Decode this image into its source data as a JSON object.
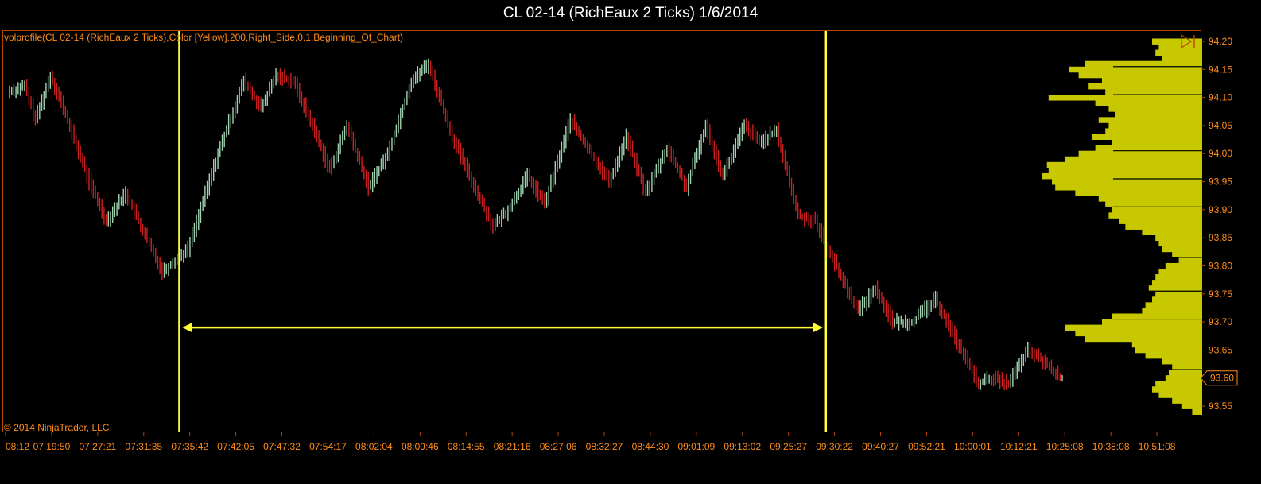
{
  "window": {
    "title": "CL 02-14 (RichEaux 2 Ticks)  1/6/2014"
  },
  "indicator_label": "volprofile(CL 02-14 (RichEaux 2 Ticks),Color [Yellow],200,Right_Side,0.1,Beginning_Of_Chart)",
  "copyright": "© 2014 NinjaTrader, LLC",
  "colors": {
    "background": "#000000",
    "up_bar": "#9fd3b0",
    "down_bar": "#cc2020",
    "volume_profile": "#c8c800",
    "annotation": "#ffff33",
    "axis_text": "#ff8c1a",
    "frame": "#b34700"
  },
  "chart_data": {
    "type": "line",
    "instrument": "CL 02-14",
    "bar_type": "RichEaux 2 Ticks",
    "date": "1/6/2014",
    "ylim": [
      93.52,
      94.21
    ],
    "y_ticks": [
      94.2,
      94.15,
      94.1,
      94.05,
      94.0,
      93.95,
      93.9,
      93.85,
      93.8,
      93.75,
      93.7,
      93.65,
      93.6,
      93.55
    ],
    "y_tick_labels": [
      "94.20",
      "94.15",
      "94.10",
      "94.05",
      "94.00",
      "93.95",
      "93.90",
      "93.85",
      "93.80",
      "93.75",
      "93.70",
      "93.65",
      "93.60",
      "93.55"
    ],
    "x_tick_labels": [
      "08:12",
      "07:19:50",
      "07:27:21",
      "07:31:35",
      "07:35:42",
      "07:42:05",
      "07:47:32",
      "07:54:17",
      "08:02:04",
      "08:09:46",
      "08:14:55",
      "08:21:16",
      "08:27:06",
      "08:32:27",
      "08:44:30",
      "09:01:09",
      "09:13:02",
      "09:25:27",
      "09:30:22",
      "09:40:27",
      "09:52:21",
      "10:00:01",
      "10:12:21",
      "10:25:08",
      "10:38:08",
      "10:51:08"
    ],
    "x_tick_count_span": 27,
    "bar_count": 220,
    "price_path": [
      {
        "bar": 0,
        "price": 94.11
      },
      {
        "bar": 8,
        "price": 94.12
      },
      {
        "bar": 13,
        "price": 94.06
      },
      {
        "bar": 20,
        "price": 94.14
      },
      {
        "bar": 26,
        "price": 94.08
      },
      {
        "bar": 38,
        "price": 93.95
      },
      {
        "bar": 46,
        "price": 93.88
      },
      {
        "bar": 55,
        "price": 93.93
      },
      {
        "bar": 62,
        "price": 93.87
      },
      {
        "bar": 72,
        "price": 93.79
      },
      {
        "bar": 84,
        "price": 93.83
      },
      {
        "bar": 98,
        "price": 94.0
      },
      {
        "bar": 110,
        "price": 94.13
      },
      {
        "bar": 118,
        "price": 94.08
      },
      {
        "bar": 125,
        "price": 94.14
      },
      {
        "bar": 133,
        "price": 94.13
      },
      {
        "bar": 143,
        "price": 94.04
      },
      {
        "bar": 150,
        "price": 93.97
      },
      {
        "bar": 158,
        "price": 94.05
      },
      {
        "bar": 168,
        "price": 93.94
      },
      {
        "bar": 177,
        "price": 94.0
      },
      {
        "bar": 188,
        "price": 94.13
      },
      {
        "bar": 196,
        "price": 94.16
      },
      {
        "bar": 207,
        "price": 94.03
      },
      {
        "bar": 215,
        "price": 93.96
      },
      {
        "bar": 226,
        "price": 93.87
      },
      {
        "bar": 233,
        "price": 93.9
      },
      {
        "bar": 242,
        "price": 93.96
      },
      {
        "bar": 250,
        "price": 93.91
      },
      {
        "bar": 262,
        "price": 94.06
      },
      {
        "bar": 270,
        "price": 94.01
      },
      {
        "bar": 280,
        "price": 93.95
      },
      {
        "bar": 288,
        "price": 94.03
      },
      {
        "bar": 297,
        "price": 93.93
      },
      {
        "bar": 307,
        "price": 94.01
      },
      {
        "bar": 316,
        "price": 93.94
      },
      {
        "bar": 325,
        "price": 94.05
      },
      {
        "bar": 333,
        "price": 93.96
      },
      {
        "bar": 343,
        "price": 94.05
      },
      {
        "bar": 350,
        "price": 94.02
      },
      {
        "bar": 358,
        "price": 94.04
      },
      {
        "bar": 368,
        "price": 93.89
      },
      {
        "bar": 376,
        "price": 93.88
      },
      {
        "bar": 388,
        "price": 93.78
      },
      {
        "bar": 396,
        "price": 93.72
      },
      {
        "bar": 404,
        "price": 93.76
      },
      {
        "bar": 412,
        "price": 93.7
      },
      {
        "bar": 421,
        "price": 93.7
      },
      {
        "bar": 432,
        "price": 93.74
      },
      {
        "bar": 440,
        "price": 93.68
      },
      {
        "bar": 452,
        "price": 93.59
      },
      {
        "bar": 458,
        "price": 93.6
      },
      {
        "bar": 466,
        "price": 93.59
      },
      {
        "bar": 475,
        "price": 93.65
      },
      {
        "bar": 482,
        "price": 93.63
      },
      {
        "bar": 490,
        "price": 93.6
      }
    ],
    "volume_profile": [
      {
        "price": 94.2,
        "volume": 0.3
      },
      {
        "price": 94.19,
        "volume": 0.26
      },
      {
        "price": 94.18,
        "volume": 0.28
      },
      {
        "price": 94.17,
        "volume": 0.24
      },
      {
        "price": 94.16,
        "volume": 0.7
      },
      {
        "price": 94.15,
        "volume": 0.8
      },
      {
        "price": 94.14,
        "volume": 0.74
      },
      {
        "price": 94.13,
        "volume": 0.6
      },
      {
        "price": 94.12,
        "volume": 0.68
      },
      {
        "price": 94.11,
        "volume": 0.58
      },
      {
        "price": 94.1,
        "volume": 0.92
      },
      {
        "price": 94.09,
        "volume": 0.64
      },
      {
        "price": 94.08,
        "volume": 0.56
      },
      {
        "price": 94.07,
        "volume": 0.52
      },
      {
        "price": 94.06,
        "volume": 0.62
      },
      {
        "price": 94.05,
        "volume": 0.56
      },
      {
        "price": 94.04,
        "volume": 0.58
      },
      {
        "price": 94.03,
        "volume": 0.66
      },
      {
        "price": 94.02,
        "volume": 0.54
      },
      {
        "price": 94.01,
        "volume": 0.64
      },
      {
        "price": 94.0,
        "volume": 0.74
      },
      {
        "price": 93.99,
        "volume": 0.82
      },
      {
        "price": 93.98,
        "volume": 0.93
      },
      {
        "price": 93.97,
        "volume": 0.92
      },
      {
        "price": 93.96,
        "volume": 0.96
      },
      {
        "price": 93.95,
        "volume": 0.9
      },
      {
        "price": 93.94,
        "volume": 0.88
      },
      {
        "price": 93.93,
        "volume": 0.76
      },
      {
        "price": 93.92,
        "volume": 0.62
      },
      {
        "price": 93.91,
        "volume": 0.58
      },
      {
        "price": 93.9,
        "volume": 0.54
      },
      {
        "price": 93.89,
        "volume": 0.56
      },
      {
        "price": 93.88,
        "volume": 0.5
      },
      {
        "price": 93.87,
        "volume": 0.46
      },
      {
        "price": 93.86,
        "volume": 0.36
      },
      {
        "price": 93.85,
        "volume": 0.28
      },
      {
        "price": 93.84,
        "volume": 0.26
      },
      {
        "price": 93.83,
        "volume": 0.24
      },
      {
        "price": 93.82,
        "volume": 0.18
      },
      {
        "price": 93.81,
        "volume": 0.14
      },
      {
        "price": 93.8,
        "volume": 0.22
      },
      {
        "price": 93.79,
        "volume": 0.26
      },
      {
        "price": 93.78,
        "volume": 0.28
      },
      {
        "price": 93.77,
        "volume": 0.3
      },
      {
        "price": 93.76,
        "volume": 0.32
      },
      {
        "price": 93.75,
        "volume": 0.28
      },
      {
        "price": 93.74,
        "volume": 0.3
      },
      {
        "price": 93.73,
        "volume": 0.34
      },
      {
        "price": 93.72,
        "volume": 0.36
      },
      {
        "price": 93.71,
        "volume": 0.54
      },
      {
        "price": 93.7,
        "volume": 0.6
      },
      {
        "price": 93.69,
        "volume": 0.82
      },
      {
        "price": 93.68,
        "volume": 0.76
      },
      {
        "price": 93.67,
        "volume": 0.7
      },
      {
        "price": 93.66,
        "volume": 0.42
      },
      {
        "price": 93.65,
        "volume": 0.4
      },
      {
        "price": 93.64,
        "volume": 0.34
      },
      {
        "price": 93.63,
        "volume": 0.24
      },
      {
        "price": 93.62,
        "volume": 0.18
      },
      {
        "price": 93.61,
        "volume": 0.2
      },
      {
        "price": 93.6,
        "volume": 0.22
      },
      {
        "price": 93.59,
        "volume": 0.28
      },
      {
        "price": 93.58,
        "volume": 0.3
      },
      {
        "price": 93.57,
        "volume": 0.26
      },
      {
        "price": 93.56,
        "volume": 0.18
      },
      {
        "price": 93.55,
        "volume": 0.12
      },
      {
        "price": 93.54,
        "volume": 0.06
      }
    ],
    "profile_levels": [
      94.16,
      94.11,
      94.01,
      93.96,
      93.91,
      93.82,
      93.76,
      93.71,
      93.62
    ],
    "current_price": {
      "value": 93.6,
      "label": "93.60"
    },
    "annotations": {
      "vertical_lines_at_bar": [
        79,
        380
      ],
      "arrow": {
        "from_bar": 79,
        "to_bar": 380,
        "price": 93.69
      }
    },
    "grid": false,
    "legend": "none"
  }
}
